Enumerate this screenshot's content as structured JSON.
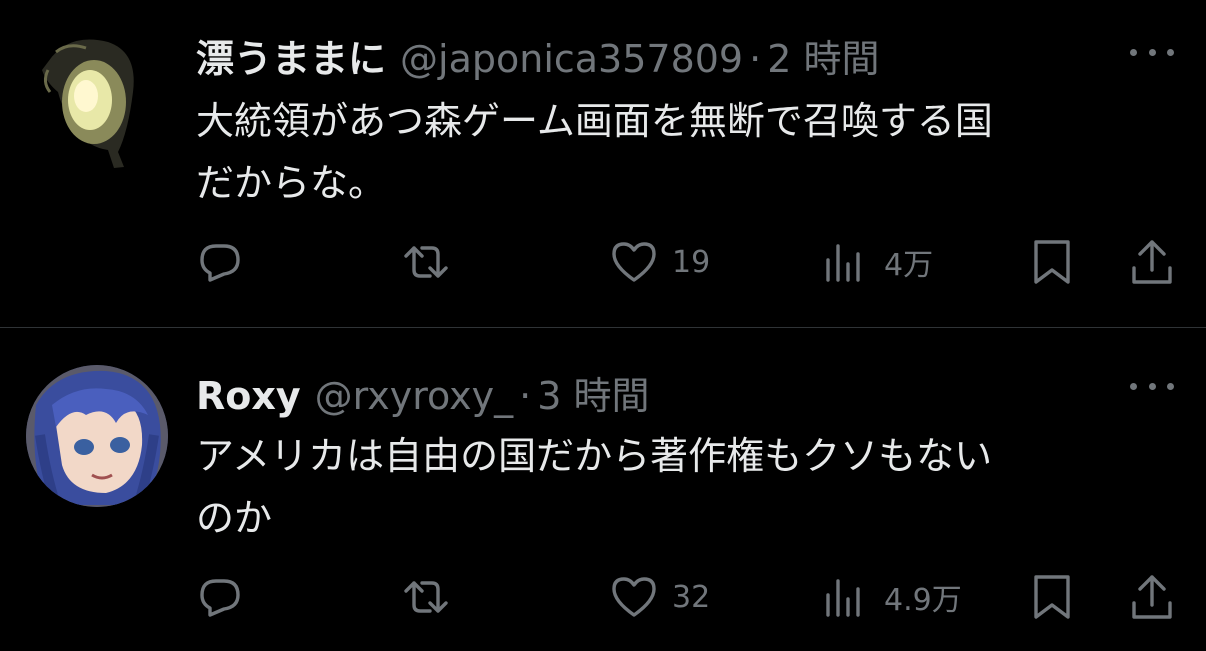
{
  "tweets": [
    {
      "display_name": "漂うままに",
      "handle": "@japonica357809",
      "separator": "·",
      "time": "2 時間",
      "text": "大統領があつ森ゲーム画面を無断で召喚する国\nだからな。",
      "likes": "19",
      "views": "4万"
    },
    {
      "display_name": "Roxy",
      "handle": "@rxyroxy_",
      "separator": "·",
      "time": "3 時間",
      "text": "アメリカは自由の国だから著作権もクソもない\nのか",
      "likes": "32",
      "views": "4.9万"
    }
  ],
  "icons": {
    "reply": "reply-icon",
    "retweet": "retweet-icon",
    "like": "heart-icon",
    "views": "views-icon",
    "bookmark": "bookmark-icon",
    "share": "share-icon",
    "more": "more-dots-icon"
  },
  "colors": {
    "background": "#000000",
    "primary_text": "#e7e9ea",
    "secondary_text": "#71767b",
    "divider": "#2f3336"
  }
}
